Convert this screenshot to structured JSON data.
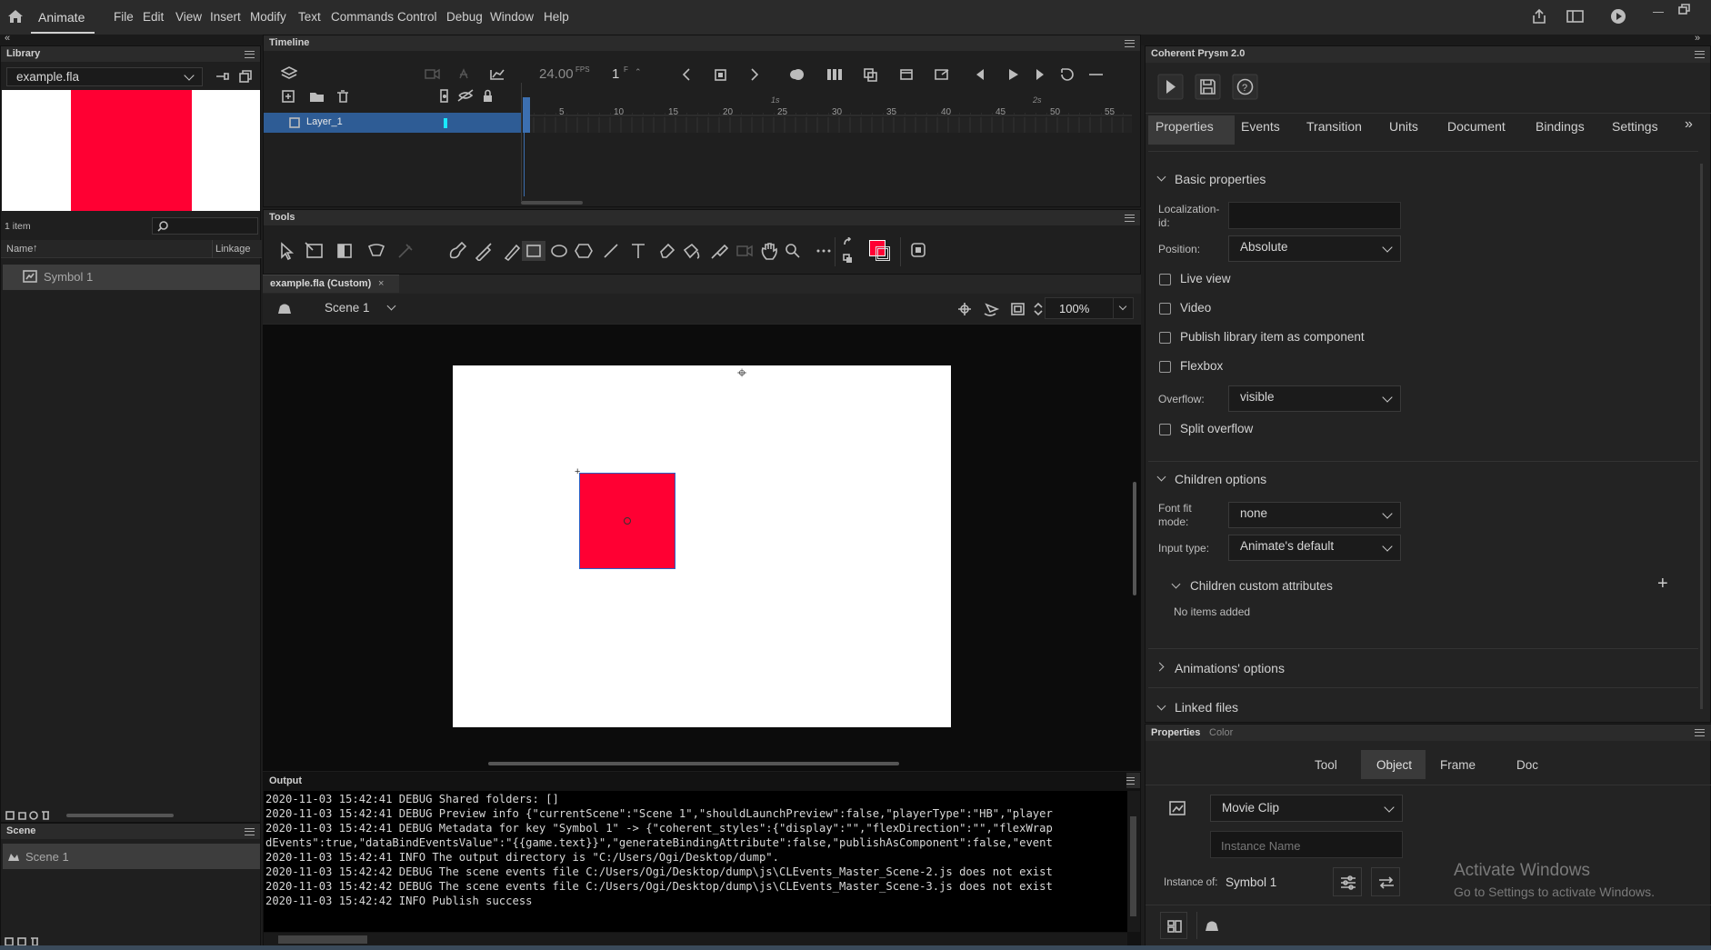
{
  "menubar": {
    "app_name": "Animate",
    "items": [
      "File",
      "Edit",
      "View",
      "Insert",
      "Modify",
      "Text",
      "Commands",
      "Control",
      "Debug",
      "Window",
      "Help"
    ]
  },
  "library": {
    "title": "Library",
    "file": "example.fla",
    "item_count": "1 item",
    "col_name": "Name",
    "col_linkage": "Linkage",
    "items": [
      "Symbol 1"
    ]
  },
  "scene_panel": {
    "title": "Scene",
    "items": [
      "Scene 1"
    ]
  },
  "timeline": {
    "title": "Timeline",
    "fps": "24.00",
    "fps_unit": "FPS",
    "frame": "1",
    "frame_unit": "F",
    "layer": "Layer_1",
    "ruler": [
      "5",
      "10",
      "15",
      "20",
      "25",
      "30",
      "35",
      "40",
      "45",
      "50",
      "55"
    ],
    "sec_marks": [
      "1s",
      "2s"
    ]
  },
  "tools": {
    "title": "Tools"
  },
  "stage": {
    "doc_tab": "example.fla (Custom)",
    "scene": "Scene 1",
    "zoom": "100%"
  },
  "output": {
    "title": "Output",
    "lines": [
      "2020-11-03 15:42:41 DEBUG Shared folders: []",
      "2020-11-03 15:42:41 DEBUG Preview info {\"currentScene\":\"Scene 1\",\"shouldLaunchPreview\":false,\"playerType\":\"HB\",\"player",
      "2020-11-03 15:42:41 DEBUG Metadata for key \"Symbol 1\" -> {\"coherent_styles\":{\"display\":\"\",\"flexDirection\":\"\",\"flexWrap",
      "dEvents\":true,\"dataBindEventsValue\":\"{{game.text}}\",\"generateBindingAttribute\":false,\"publishAsComponent\":false,\"event",
      "2020-11-03 15:42:41 INFO The output directory is \"C:/Users/Ogi/Desktop/dump\".",
      "2020-11-03 15:42:42 DEBUG The scene events file C:/Users/Ogi/Desktop/dump\\js\\CLEvents_Master_Scene-2.js does not exist",
      "2020-11-03 15:42:42 DEBUG The scene events file C:/Users/Ogi/Desktop/dump\\js\\CLEvents_Master_Scene-3.js does not exist",
      "2020-11-03 15:42:42 INFO Publish success"
    ]
  },
  "prysm": {
    "title": "Coherent Prysm 2.0",
    "tabs": [
      "Properties",
      "Events",
      "Transition",
      "Units",
      "Document",
      "Bindings",
      "Settings"
    ],
    "basic_properties": "Basic properties",
    "localization_label": "Localization-id:",
    "position_label": "Position:",
    "position_value": "Absolute",
    "checkboxes": [
      "Live view",
      "Video",
      "Publish library item as component",
      "Flexbox"
    ],
    "overflow_label": "Overflow:",
    "overflow_value": "visible",
    "split_overflow": "Split overflow",
    "children_options": "Children options",
    "font_fit_label": "Font fit mode:",
    "font_fit_value": "none",
    "input_type_label": "Input type:",
    "input_type_value": "Animate's default",
    "children_custom": "Children custom attributes",
    "no_items": "No items added",
    "animations_options": "Animations' options",
    "linked_files": "Linked files"
  },
  "props": {
    "tabs": [
      "Properties",
      "Color"
    ],
    "subtabs": [
      "Tool",
      "Object",
      "Frame",
      "Doc"
    ],
    "type_value": "Movie Clip",
    "instance_placeholder": "Instance Name",
    "instance_of_label": "Instance of:",
    "instance_of_value": "Symbol 1"
  },
  "watermark": {
    "line1": "Activate Windows",
    "line2": "Go to Settings to activate Windows."
  },
  "colors": {
    "accent": "#0f64c8",
    "symbol": "#ff0033",
    "layer_sel": "#2e5c95"
  }
}
